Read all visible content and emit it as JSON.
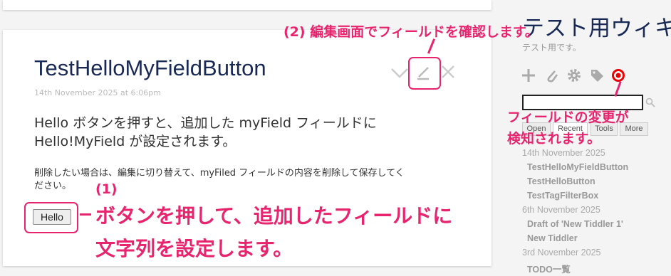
{
  "tiddler": {
    "title": "TestHelloMyFieldButton",
    "date": "14th November 2025 at 6:06pm",
    "body_line1": "Hello ボタンを押すと、追加した myField フィールドに",
    "body_line2": "Hello!MyField が設定されます。",
    "body_small_line1": "削除したい場合は、編集に切り替えて、myFiled フィールドの内容を削除して保存してく",
    "body_small_line2": "ださい。",
    "button_label": "Hello"
  },
  "toolbar": {
    "icons": [
      "chevron-down-icon",
      "edit-pencil-icon",
      "close-icon"
    ]
  },
  "sidebar": {
    "site_title": "テスト用ウィキ",
    "site_subtitle": "テスト用です。",
    "page_controls": [
      "plus-icon",
      "paperclip-icon",
      "gear-icon",
      "tag-icon",
      "unsaved-changes-icon"
    ],
    "search_placeholder": "",
    "tabs": [
      "Open",
      "Recent",
      "Tools",
      "More"
    ],
    "recent": [
      {
        "date": "14th November 2025",
        "items": [
          "TestHelloMyFieldButton",
          "TestHelloButton",
          "TestTagFilterBox"
        ]
      },
      {
        "date": "6th November 2025",
        "items": [
          "Draft of 'New Tiddler 1'",
          "New Tiddler"
        ]
      },
      {
        "date": "3rd November 2025",
        "items": [
          "TODO一覧"
        ]
      }
    ]
  },
  "annotations": {
    "step2": "(2) 編集画面でフィールドを確認します。",
    "step1_label": "(1)",
    "step1_line1": "ボタンを押して、追加したフィールドに",
    "step1_line2": "文字列を設定します。",
    "change_line1": "フィールドの変更が",
    "change_line2": "検知されます。",
    "accent_color": "#e8246e"
  }
}
